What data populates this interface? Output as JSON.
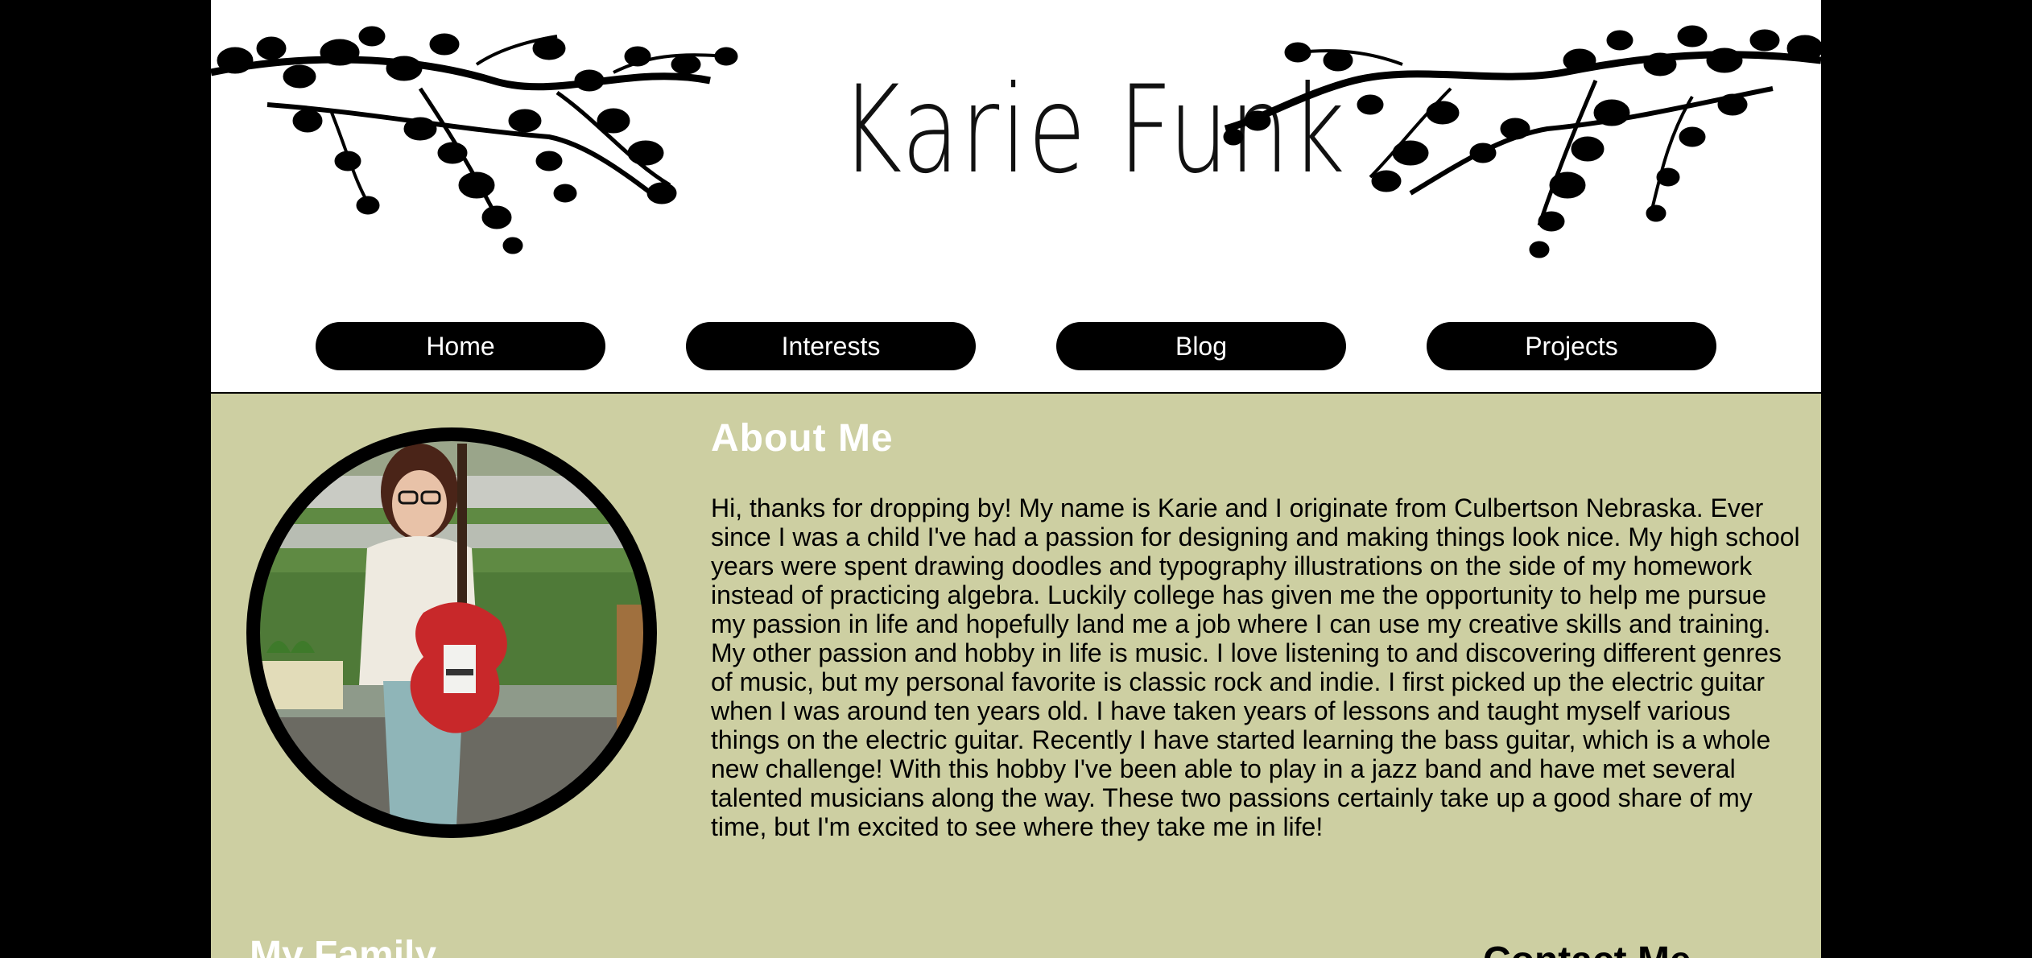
{
  "header": {
    "title": "Karie Funk"
  },
  "nav": {
    "items": [
      {
        "label": "Home"
      },
      {
        "label": "Interests"
      },
      {
        "label": "Blog"
      },
      {
        "label": "Projects"
      }
    ]
  },
  "about": {
    "title": "About Me",
    "paragraphs": [
      "Hi, thanks for dropping by! My name is Karie and I originate from Culbertson Nebraska. Ever since I was a child I've had a passion for designing and making things look nice. My high school years were spent drawing doodles and typography illustrations on the side of my homework instead of practicing algebra. Luckily college has given me the opportunity to help me pursue my passion in life and hopefully land me a job where I can use my creative skills and training.",
      "My other passion and hobby in life is music. I love listening to and discovering different genres of music, but my personal favorite is classic rock and indie. I first picked up the electric guitar when I was around ten years old. I have taken years of lessons and taught myself various things on the electric guitar. Recently I have started learning the bass guitar, which is a whole new challenge! With this hobby I've been able to play in a jazz band and have met several talented musicians along the way. These two passions certainly take up a good share of my time, but I'm excited to see where they take me in life!"
    ]
  },
  "family": {
    "title": "My Family"
  },
  "contact": {
    "title": "Contact Me"
  },
  "colors": {
    "background": "#000000",
    "content_bg": "#cdcfa2",
    "nav_bg": "#000000"
  },
  "icons": [
    "branch-left-icon",
    "branch-right-icon"
  ]
}
